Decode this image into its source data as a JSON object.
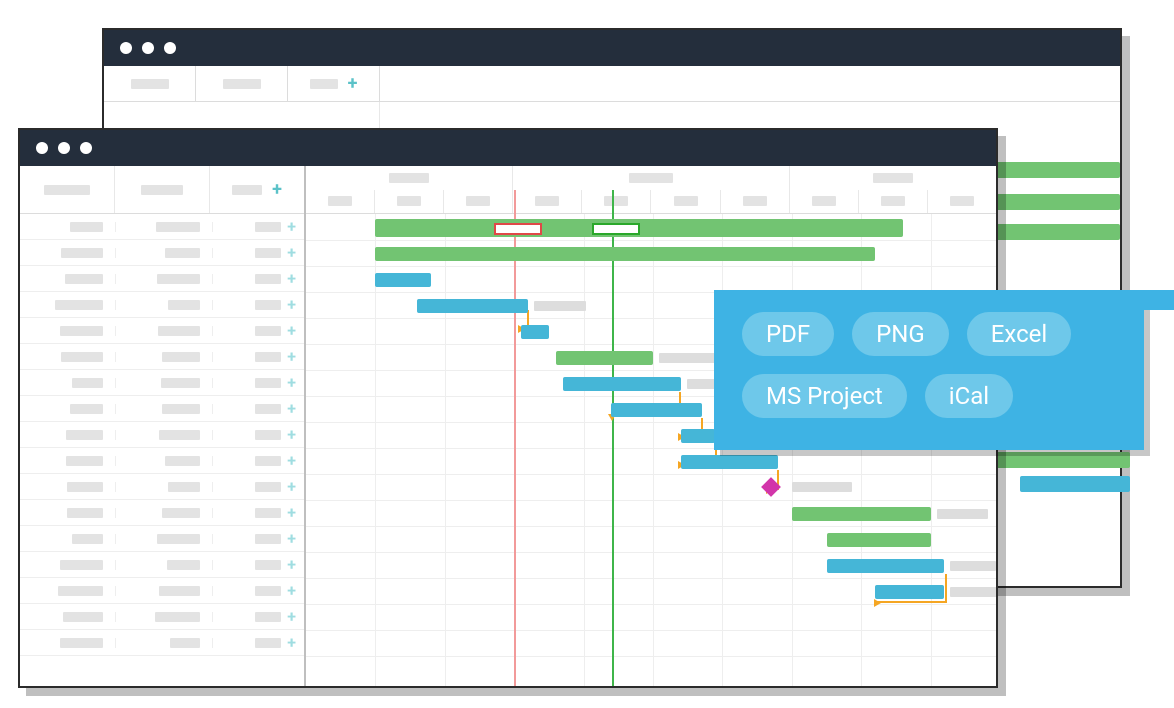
{
  "export": {
    "options": [
      "PDF",
      "PNG",
      "Excel",
      "MS Project",
      "iCal"
    ]
  },
  "colors": {
    "green": "#72c472",
    "teal": "#45b6d7",
    "orange_arrow": "#f5a623",
    "milestone": "#d235aa",
    "today_line": "#f29a9a",
    "deadline_line": "#3fb54a",
    "popover": "#3eb3e4"
  },
  "grid": {
    "columns": 3,
    "rows": 17,
    "timeline_columns": 10
  },
  "chart_data": {
    "type": "gantt",
    "title": "",
    "timeline_units": 10,
    "today_position": 3.0,
    "deadline_position": 4.4,
    "tasks": [
      {
        "row": 0,
        "start": 1.0,
        "end": 8.6,
        "color": "green",
        "summary": true
      },
      {
        "row": 1,
        "start": 1.0,
        "end": 8.2,
        "color": "green"
      },
      {
        "row": 2,
        "start": 1.0,
        "end": 1.8,
        "color": "teal"
      },
      {
        "row": 3,
        "start": 1.6,
        "end": 3.2,
        "color": "teal"
      },
      {
        "row": 4,
        "start": 3.1,
        "end": 3.5,
        "color": "teal"
      },
      {
        "row": 5,
        "start": 3.6,
        "end": 5.0,
        "color": "green"
      },
      {
        "row": 6,
        "start": 3.7,
        "end": 5.4,
        "color": "teal"
      },
      {
        "row": 7,
        "start": 4.4,
        "end": 5.7,
        "color": "teal"
      },
      {
        "row": 8,
        "start": 5.4,
        "end": 5.9,
        "color": "teal"
      },
      {
        "row": 9,
        "start": 5.4,
        "end": 6.8,
        "color": "teal"
      },
      {
        "row": 10,
        "start": 6.7,
        "end": 7.0,
        "color": "milestone"
      },
      {
        "row": 11,
        "start": 7.0,
        "end": 9.0,
        "color": "green"
      },
      {
        "row": 12,
        "start": 7.5,
        "end": 9.0,
        "color": "green"
      },
      {
        "row": 13,
        "start": 7.5,
        "end": 9.2,
        "color": "teal"
      },
      {
        "row": 14,
        "start": 8.2,
        "end": 9.2,
        "color": "teal"
      }
    ],
    "dependencies": [
      {
        "from_row": 3,
        "to_row": 4
      },
      {
        "from_row": 6,
        "to_row": 7
      },
      {
        "from_row": 7,
        "to_row": 8
      },
      {
        "from_row": 8,
        "to_row": 9
      },
      {
        "from_row": 9,
        "to_row": 10
      },
      {
        "from_row": 13,
        "to_row": 14
      }
    ]
  }
}
